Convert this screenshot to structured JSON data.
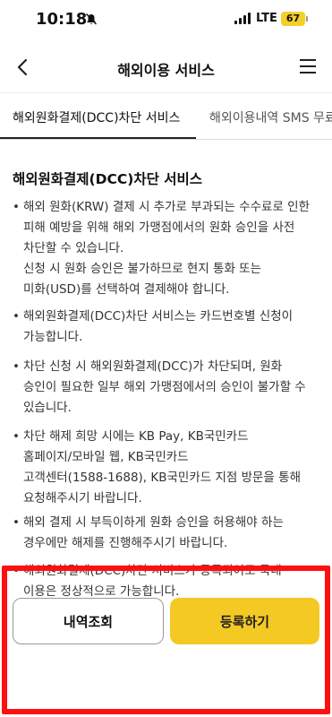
{
  "status_bar": {
    "time": "10:18",
    "network": "LTE",
    "battery": "67",
    "icons": [
      "bell-mute-icon",
      "signal-icon",
      "battery-icon"
    ]
  },
  "header": {
    "title": "해외이용 서비스",
    "icons": [
      "back-icon",
      "menu-icon"
    ]
  },
  "tabs": [
    {
      "label": "해외원화결제(DCC)차단 서비스",
      "active": true
    },
    {
      "label": "해외이용내역 SMS 무료",
      "active": false
    }
  ],
  "main": {
    "section_title": "해외원화결제(DCC)차단 서비스",
    "bullet_marker": "•",
    "bullets": [
      {
        "lines": [
          "해외 원화(KRW) 결제 시 추가로 부과되는 수수료로 인한",
          "피해 예방을 위해 해외 가맹점에서의 원화 승인을 사전",
          "차단할 수 있습니다.",
          "신청 시 원화 승인은 불가하므로 현지 통화 또는",
          "미화(USD)를 선택하여 결제해야 합니다."
        ]
      },
      {
        "lines": [
          "해외원화결제(DCC)차단 서비스는 카드번호별 신청이",
          "가능합니다."
        ]
      },
      {
        "lines": [
          "차단 신청 시 해외원화결제(DCC)가 차단되며, 원화",
          "승인이 필요한 일부 해외 가맹점에서의 승인이 불가할 수",
          "있습니다."
        ]
      },
      {
        "lines": [
          "차단 해제 희망 시에는 KB Pay, KB국민카드",
          "홈페이지/모바일 웹, KB국민카드",
          "고객센터(1588-1688), KB국민카드 지점 방문을 통해",
          "요청해주시기 바랍니다."
        ]
      },
      {
        "lines": [
          "해외 결제 시 부득이하게 원화 승인을 허용해야 하는",
          "경우에만 해제를 진행해주시기 바랍니다."
        ]
      },
      {
        "lines": [
          "해외원화결제(DCC)차단 서비스가 등록되어도 국내",
          "이용은 정상적으로 가능합니다."
        ]
      }
    ]
  },
  "actions": {
    "history_label": "내역조회",
    "register_label": "등록하기"
  },
  "colors": {
    "accent": "#f5c924",
    "highlight_frame": "#ff1010",
    "battery": "#f5cf2a"
  }
}
